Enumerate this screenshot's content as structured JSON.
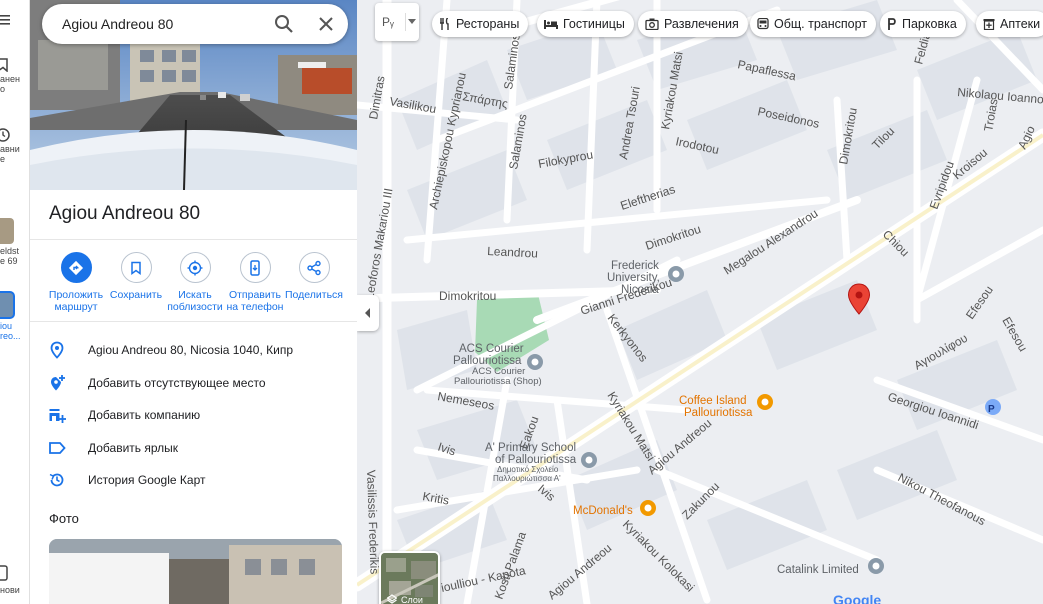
{
  "search": {
    "query": "Agiou Andreou 80"
  },
  "rail": {
    "items": [
      {
        "icon": "bookmark-icon",
        "text": "анен\nо"
      },
      {
        "icon": "history-icon",
        "text": "авни\nе"
      },
      {
        "icon": "thumbnail",
        "text": "eldst\ne 69"
      },
      {
        "icon": "thumbnail-selected",
        "text": "iou\nreo..."
      },
      {
        "icon": "phone-icon",
        "text": "нови"
      }
    ]
  },
  "place": {
    "title": "Agiou Andreou 80",
    "actions": [
      {
        "icon": "directions-icon",
        "label": "Проложить маршрут"
      },
      {
        "icon": "bookmark-icon",
        "label": "Сохранить"
      },
      {
        "icon": "nearby-icon",
        "label": "Искать поблизости"
      },
      {
        "icon": "send-to-phone-icon",
        "label": "Отправить на телефон"
      },
      {
        "icon": "share-icon",
        "label": "Поделиться"
      }
    ],
    "info": [
      {
        "icon": "location-pin-icon",
        "text": "Agiou Andreou 80, Nicosia 1040, Кипр"
      },
      {
        "icon": "add-place-icon",
        "text": "Добавить отсутствующее место"
      },
      {
        "icon": "add-business-icon",
        "text": "Добавить компанию"
      },
      {
        "icon": "label-icon",
        "text": "Добавить ярлык"
      },
      {
        "icon": "history-icon",
        "text": "История Google Карт"
      }
    ],
    "photos_heading": "Фото"
  },
  "map": {
    "lang_button": "Pᵧ",
    "chips": [
      {
        "icon": "restaurant-icon",
        "label": "Рестораны"
      },
      {
        "icon": "hotel-icon",
        "label": "Гостиницы"
      },
      {
        "icon": "camera-icon",
        "label": "Развлечения"
      },
      {
        "icon": "bus-icon",
        "label": "Общ. транспорт"
      },
      {
        "icon": "parking-icon",
        "label": "Парковка"
      },
      {
        "icon": "pharmacy-icon",
        "label": "Аптеки"
      }
    ],
    "layers_label": "Слои",
    "logo": "Google",
    "streets": [
      "Dimitras",
      "Vasilikou",
      "Σπάρτης",
      "Archiepiskopou Kyprianou",
      "Salaminos",
      "Andrea Tsouri",
      "Kyriakou Matsi",
      "Papaflessa",
      "Poseidonos",
      "Nikolaou Ioanno",
      "Troias",
      "Filokyprou",
      "Irodotou",
      "Dimokritou",
      "Tilou",
      "Evripidou",
      "Kroisou",
      "Eleftherias",
      "Leandrou",
      "Megalou Alexandrou",
      "Chiou",
      "Gianni Frederikou",
      "Efesou",
      "Kerkyonos",
      "Αγιουλίφου",
      "Nemeseos",
      "Georgiou Ioannidi",
      "Ivis",
      "Eakou",
      "Kritis",
      "Agiou Andreou",
      "Zakunou",
      "Nikou Theofanous",
      "Kosti Palama",
      "Kyriakou Kolokasi",
      "Vasilissis Frederikis",
      "Leoforos Makariou III",
      "Agiou Andreou Kapota",
      "Feldia",
      "Agio"
    ],
    "places": [
      {
        "name": "Frederick University, Nicosia",
        "type": "university"
      },
      {
        "name": "ACS Courier Pallouriotissa",
        "sub": "ACS Courier Pallouriotissa (Shop)",
        "type": "shop"
      },
      {
        "name": "A' Primary School of Pallouriotissa",
        "sub": "Δημοτικό Σχολείο Παλλουριώτισσα Α'",
        "type": "school"
      },
      {
        "name": "Coffee Island Pallouriotissa",
        "type": "cafe"
      },
      {
        "name": "McDonald's",
        "type": "restaurant"
      },
      {
        "name": "Catalink Limited",
        "type": "business"
      }
    ]
  }
}
